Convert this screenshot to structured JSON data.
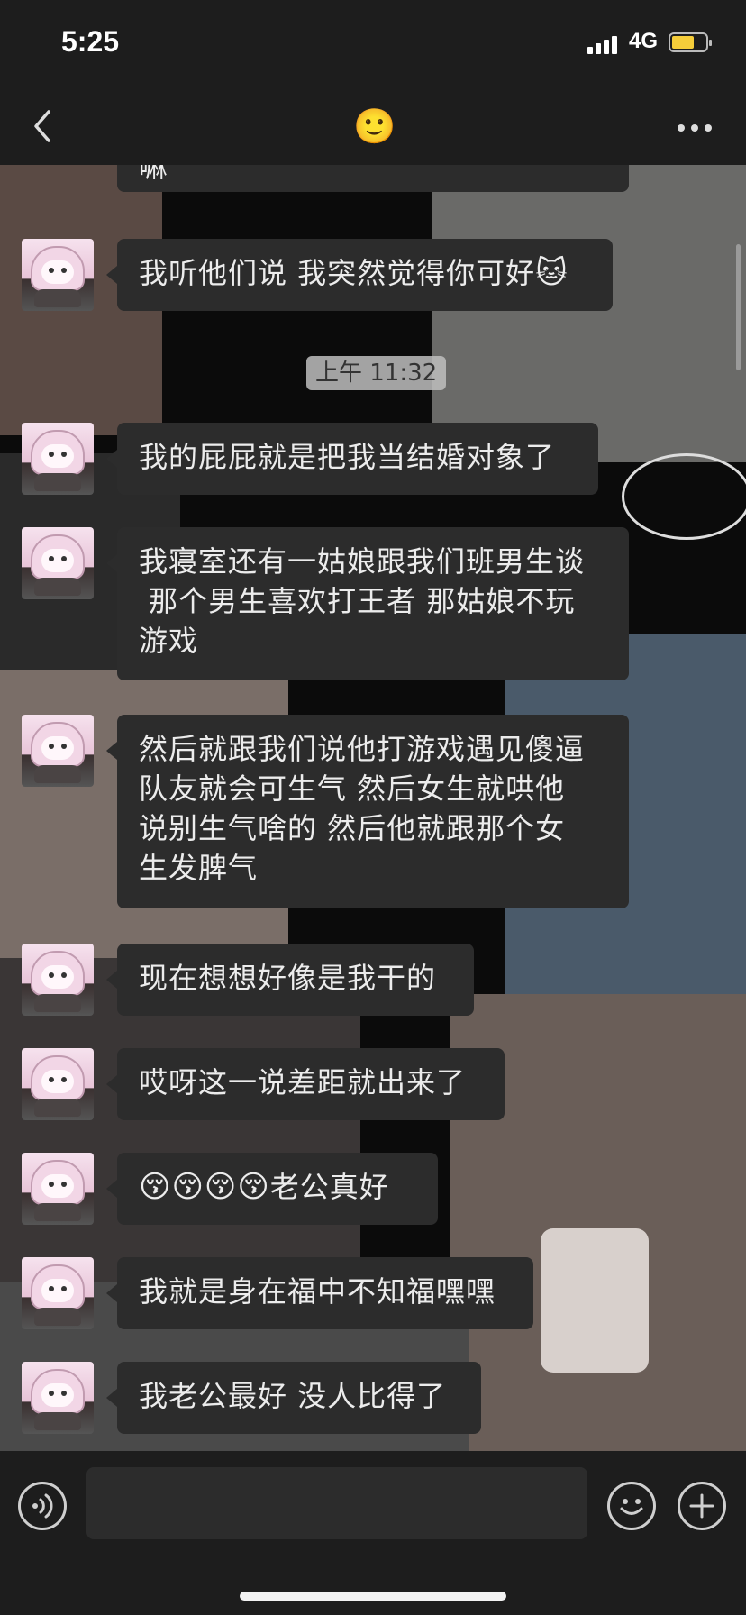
{
  "status_bar": {
    "time": "5:25",
    "network": "4G"
  },
  "nav": {
    "title_emoji": "🙂"
  },
  "colors": {
    "background": "#000000",
    "bar": "#1d1d1d",
    "bubble": "#2c2c2c",
    "battery": "#f5cd3a"
  },
  "icons": {
    "back": "chevron-left-icon",
    "more": "more-horizontal-icon",
    "voice": "voice-icon",
    "emoji": "smile-icon",
    "plus": "plus-icon"
  },
  "chat": {
    "timestamp": "上午 11:32",
    "messages": [
      {
        "text": "嘛"
      },
      {
        "text": "我听他们说 我突然觉得你可好",
        "emoji": "🐱"
      },
      {
        "text": "我的屁屁就是把我当结婚对象了"
      },
      {
        "text": "我寝室还有一姑娘跟我们班男生谈\n 那个男生喜欢打王者 那姑娘不玩\n游戏"
      },
      {
        "text": "然后就跟我们说他打游戏遇见傻逼\n队友就会可生气 然后女生就哄他\n说别生气啥的 然后他就跟那个女\n生发脾气"
      },
      {
        "text": "现在想想好像是我干的"
      },
      {
        "text": "哎呀这一说差距就出来了"
      },
      {
        "emoji": "😚😚😚😚",
        "text": "老公真好"
      },
      {
        "text": "我就是身在福中不知福嘿嘿"
      },
      {
        "text": "我老公最好 没人比得了"
      }
    ]
  },
  "input": {
    "value": "",
    "placeholder": ""
  }
}
